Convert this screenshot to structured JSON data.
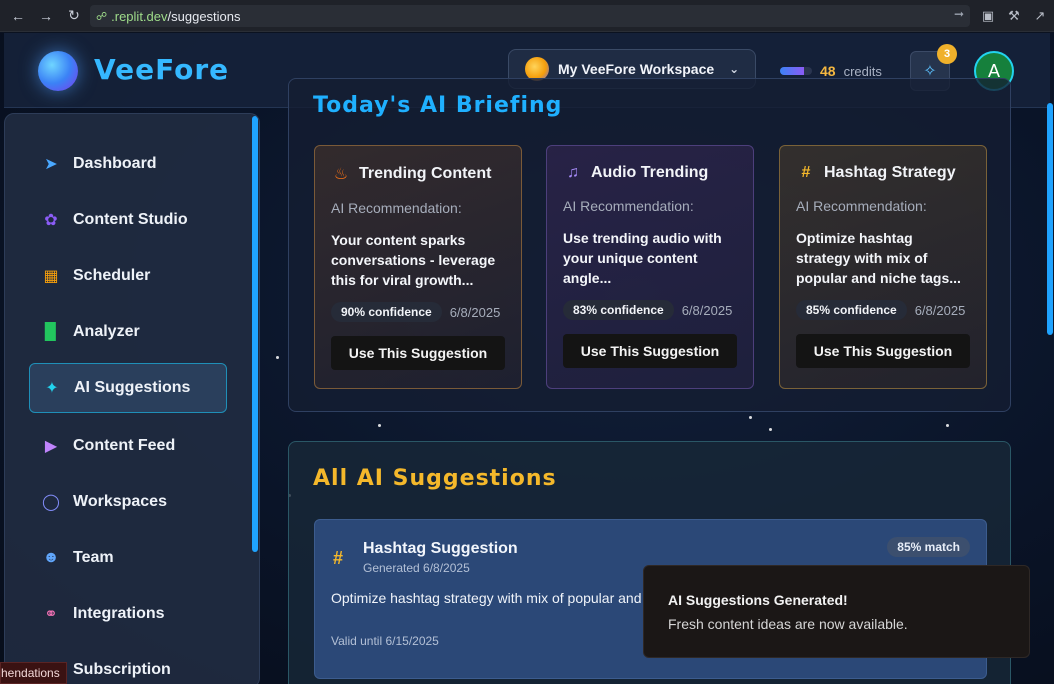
{
  "browser": {
    "url_domain": ".replit.dev",
    "url_path": "/suggestions"
  },
  "header": {
    "brand": "VeeFore",
    "workspace_label": "My VeeFore Workspace",
    "credits_value": "48",
    "credits_label": "credits",
    "credits_fill_percent": 75,
    "notification_count": "3",
    "user_initial": "A"
  },
  "sidebar": {
    "items": [
      {
        "label": "Dashboard",
        "icon": "rocket-icon",
        "color": "#4aa8ff"
      },
      {
        "label": "Content Studio",
        "icon": "brain-icon",
        "color": "#8b5cf6"
      },
      {
        "label": "Scheduler",
        "icon": "calendar-icon",
        "color": "#f59e0b"
      },
      {
        "label": "Analyzer",
        "icon": "bar-chart-icon",
        "color": "#22c55e"
      },
      {
        "label": "AI Suggestions",
        "icon": "sparkles-icon",
        "color": "#22d3ee"
      },
      {
        "label": "Content Feed",
        "icon": "play-circle-icon",
        "color": "#c084fc"
      },
      {
        "label": "Workspaces",
        "icon": "globe-icon",
        "color": "#818cf8"
      },
      {
        "label": "Team",
        "icon": "users-icon",
        "color": "#60a5fa"
      },
      {
        "label": "Integrations",
        "icon": "link-icon",
        "color": "#f472b6"
      },
      {
        "label": "Subscription",
        "icon": "card-icon",
        "color": "#a3a3a3"
      }
    ],
    "active_index": 4
  },
  "briefing": {
    "title": "Today's AI Briefing",
    "cards": [
      {
        "title": "Trending Content",
        "icon": "flame-icon",
        "icon_color": "#f97316",
        "sub": "AI Recommendation:",
        "body": "Your content sparks conversations - leverage this for viral growth...",
        "confidence": "90% confidence",
        "date": "6/8/2025",
        "button": "Use This Suggestion"
      },
      {
        "title": "Audio Trending",
        "icon": "music-icon",
        "icon_color": "#a78bfa",
        "sub": "AI Recommendation:",
        "body": "Use trending audio with your unique content angle...",
        "confidence": "83% confidence",
        "date": "6/8/2025",
        "button": "Use This Suggestion"
      },
      {
        "title": "Hashtag Strategy",
        "icon": "hashtag-icon",
        "icon_color": "#f4b82b",
        "sub": "AI Recommendation:",
        "body": "Optimize hashtag strategy with mix of popular and niche tags...",
        "confidence": "85% confidence",
        "date": "6/8/2025",
        "button": "Use This Suggestion"
      }
    ]
  },
  "all_suggestions": {
    "title": "All AI Suggestions",
    "item": {
      "title": "Hashtag Suggestion",
      "generated": "Generated 6/8/2025",
      "match": "85% match",
      "text": "Optimize hashtag strategy with mix of popular and niche tags...",
      "valid": "Valid until 6/15/2025"
    }
  },
  "toast": {
    "title": "AI Suggestions Generated!",
    "message": "Fresh content ideas are now available."
  },
  "status_tip": "hendations"
}
